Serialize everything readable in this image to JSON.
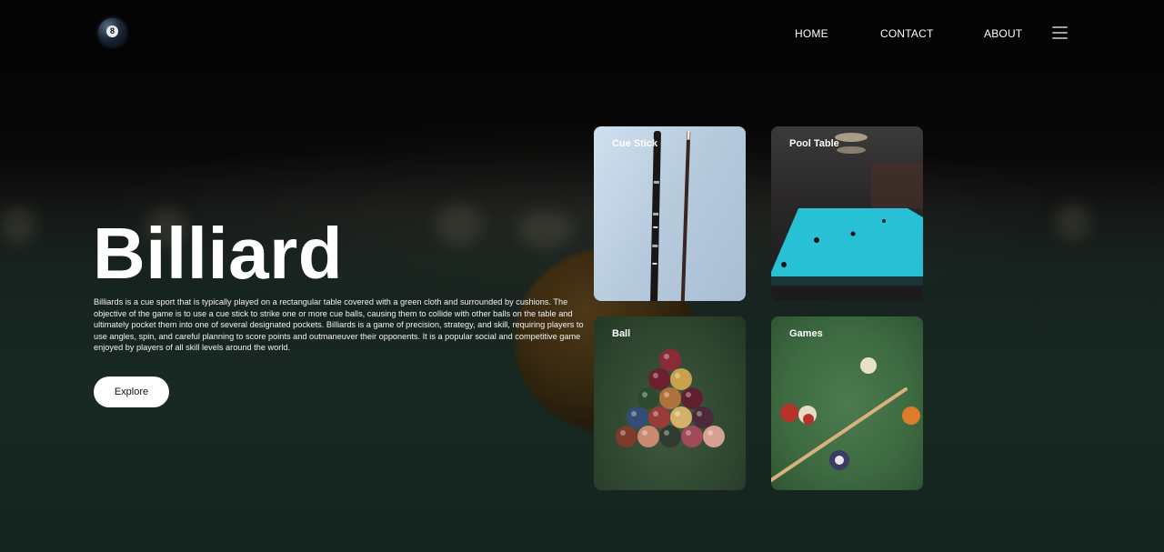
{
  "header": {
    "logo_text": "8",
    "nav": [
      {
        "label": "HOME"
      },
      {
        "label": "CONTACT"
      },
      {
        "label": "ABOUT"
      }
    ],
    "menu_icon": "hamburger-icon"
  },
  "hero": {
    "title": "Billiard",
    "description": "Billiards is a cue sport that is typically played on a rectangular table covered with a green cloth and surrounded by cushions. The objective of the game is to use a cue stick to strike one or more cue balls, causing them to collide with other balls on the table and ultimately pocket them into one of several designated pockets. Billiards is a game of precision, strategy, and skill, requiring players to use angles, spin, and careful planning to score points and outmaneuver their opponents. It is a popular social and competitive game enjoyed by players of all skill levels around the world.",
    "button_label": "Explore"
  },
  "cards": [
    {
      "label": "Cue Stick"
    },
    {
      "label": "Pool Table"
    },
    {
      "label": "Ball"
    },
    {
      "label": "Games"
    }
  ],
  "colors": {
    "background": "#0b0f0e",
    "table_felt": "#1e322b",
    "button_bg": "#ffffff",
    "text": "#ffffff"
  }
}
